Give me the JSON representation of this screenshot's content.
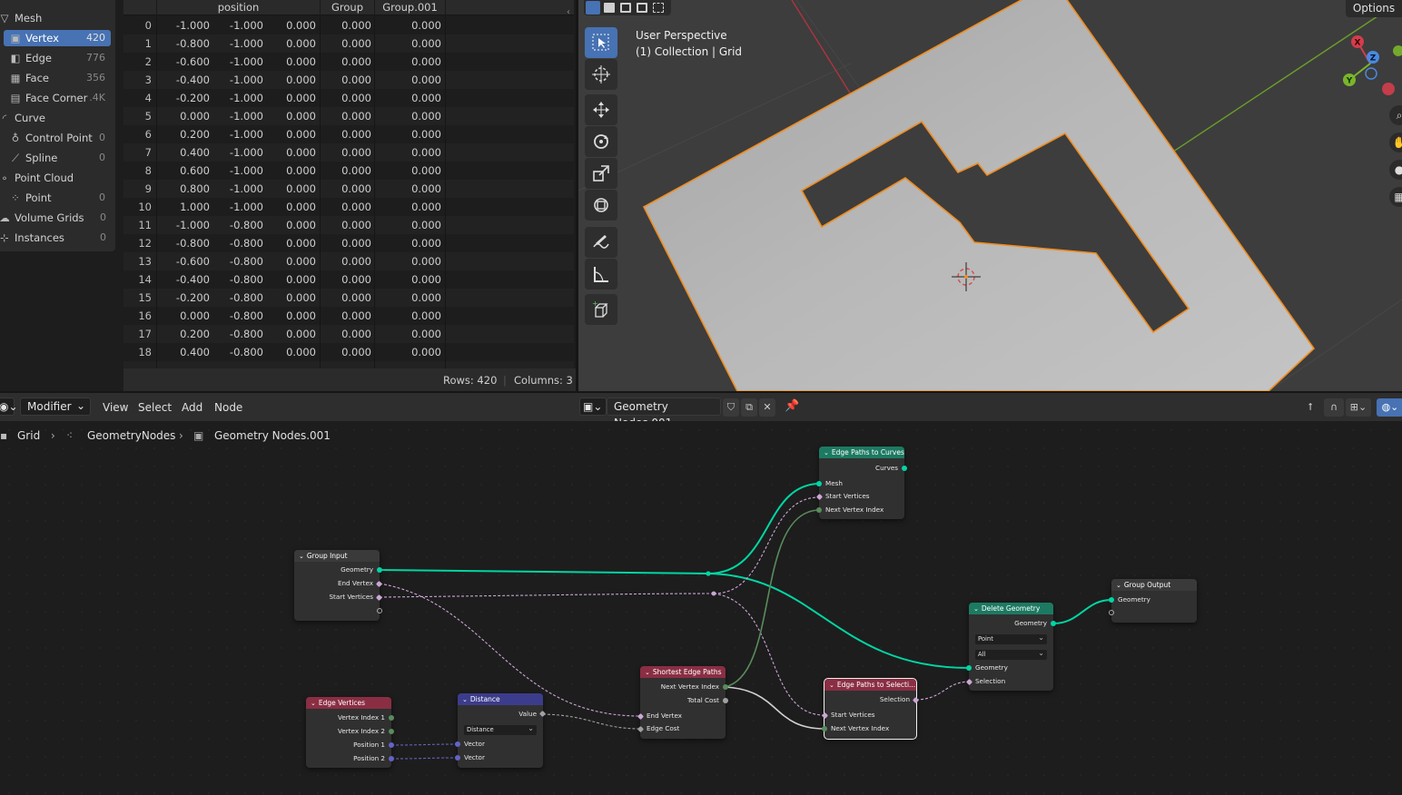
{
  "spreadsheet": {
    "sidebar": {
      "items": [
        {
          "label": "Mesh",
          "count": "",
          "icon": "mesh-icon"
        },
        {
          "label": "Vertex",
          "count": "420",
          "icon": "vertex-icon",
          "active": true
        },
        {
          "label": "Edge",
          "count": "776",
          "icon": "edge-icon"
        },
        {
          "label": "Face",
          "count": "356",
          "icon": "face-icon"
        },
        {
          "label": "Face Corner",
          "count": ".4K",
          "icon": "face-corner-icon"
        },
        {
          "label": "Curve",
          "count": "",
          "icon": "curve-icon"
        },
        {
          "label": "Control Point",
          "count": "0",
          "icon": "control-point-icon"
        },
        {
          "label": "Spline",
          "count": "0",
          "icon": "spline-icon"
        },
        {
          "label": "Point Cloud",
          "count": "",
          "icon": "point-cloud-icon"
        },
        {
          "label": "Point",
          "count": "0",
          "icon": "point-icon"
        },
        {
          "label": "Volume Grids",
          "count": "0",
          "icon": "volume-icon"
        },
        {
          "label": "Instances",
          "count": "0",
          "icon": "instances-icon"
        }
      ]
    },
    "columns": [
      "position",
      "Group",
      "Group.001"
    ],
    "rows": [
      [
        "0",
        "-1.000",
        "-1.000",
        "0.000",
        "0.000",
        "0.000"
      ],
      [
        "1",
        "-0.800",
        "-1.000",
        "0.000",
        "0.000",
        "0.000"
      ],
      [
        "2",
        "-0.600",
        "-1.000",
        "0.000",
        "0.000",
        "0.000"
      ],
      [
        "3",
        "-0.400",
        "-1.000",
        "0.000",
        "0.000",
        "0.000"
      ],
      [
        "4",
        "-0.200",
        "-1.000",
        "0.000",
        "0.000",
        "0.000"
      ],
      [
        "5",
        "0.000",
        "-1.000",
        "0.000",
        "0.000",
        "0.000"
      ],
      [
        "6",
        "0.200",
        "-1.000",
        "0.000",
        "0.000",
        "0.000"
      ],
      [
        "7",
        "0.400",
        "-1.000",
        "0.000",
        "0.000",
        "0.000"
      ],
      [
        "8",
        "0.600",
        "-1.000",
        "0.000",
        "0.000",
        "0.000"
      ],
      [
        "9",
        "0.800",
        "-1.000",
        "0.000",
        "0.000",
        "0.000"
      ],
      [
        "10",
        "1.000",
        "-1.000",
        "0.000",
        "0.000",
        "0.000"
      ],
      [
        "11",
        "-1.000",
        "-0.800",
        "0.000",
        "0.000",
        "0.000"
      ],
      [
        "12",
        "-0.800",
        "-0.800",
        "0.000",
        "0.000",
        "0.000"
      ],
      [
        "13",
        "-0.600",
        "-0.800",
        "0.000",
        "0.000",
        "0.000"
      ],
      [
        "14",
        "-0.400",
        "-0.800",
        "0.000",
        "0.000",
        "0.000"
      ],
      [
        "15",
        "-0.200",
        "-0.800",
        "0.000",
        "0.000",
        "0.000"
      ],
      [
        "16",
        "0.000",
        "-0.800",
        "0.000",
        "0.000",
        "0.000"
      ],
      [
        "17",
        "0.200",
        "-0.800",
        "0.000",
        "0.000",
        "0.000"
      ],
      [
        "18",
        "0.400",
        "-0.800",
        "0.000",
        "0.000",
        "0.000"
      ]
    ],
    "footer": {
      "rows": "Rows: 420",
      "columns": "Columns: 3"
    }
  },
  "viewport": {
    "line1": "User Perspective",
    "line2": "(1) Collection | Grid",
    "options": "Options",
    "gizmo": {
      "x": "X",
      "y": "Y",
      "z": "Z"
    },
    "colors": {
      "background": "#3d3d3d",
      "mesh": "#b8b8b8",
      "outline": "#f08c1e",
      "x_axis": "#b0343f",
      "y_axis": "#6a9e2a"
    }
  },
  "node_header": {
    "editor_type_icon": "node-editor-icon",
    "context": "Modifier",
    "menus": [
      "View",
      "Select",
      "Add",
      "Node"
    ],
    "node_group": "Geometry Nodes.001"
  },
  "breadcrumb": [
    "Grid",
    "GeometryNodes",
    "Geometry Nodes.001"
  ],
  "nodes": {
    "group_input": {
      "title": "Group Input",
      "outputs": [
        "Geometry",
        "End Vertex",
        "Start Vertices"
      ]
    },
    "edge_paths_to_curves": {
      "title": "Edge Paths to Curves",
      "outputs": [
        "Curves"
      ],
      "inputs": [
        "Mesh",
        "Start Vertices",
        "Next Vertex Index"
      ]
    },
    "edge_vertices": {
      "title": "Edge Vertices",
      "outputs": [
        "Vertex Index 1",
        "Vertex Index 2",
        "Position 1",
        "Position 2"
      ]
    },
    "distance": {
      "title": "Distance",
      "outputs": [
        "Value"
      ],
      "mode": "Distance",
      "inputs": [
        "Vector",
        "Vector"
      ]
    },
    "shortest_edge_paths": {
      "title": "Shortest Edge Paths",
      "outputs": [
        "Next Vertex Index",
        "Total Cost"
      ],
      "inputs": [
        "End Vertex",
        "Edge Cost"
      ]
    },
    "edge_paths_to_selection": {
      "title": "Edge Paths to Selecti...",
      "outputs": [
        "Selection"
      ],
      "inputs": [
        "Start Vertices",
        "Next Vertex Index"
      ]
    },
    "delete_geometry": {
      "title": "Delete Geometry",
      "outputs": [
        "Geometry"
      ],
      "domain": "Point",
      "mode": "All",
      "inputs": [
        "Geometry",
        "Selection"
      ]
    },
    "group_output": {
      "title": "Group Output",
      "inputs": [
        "Geometry"
      ]
    }
  }
}
